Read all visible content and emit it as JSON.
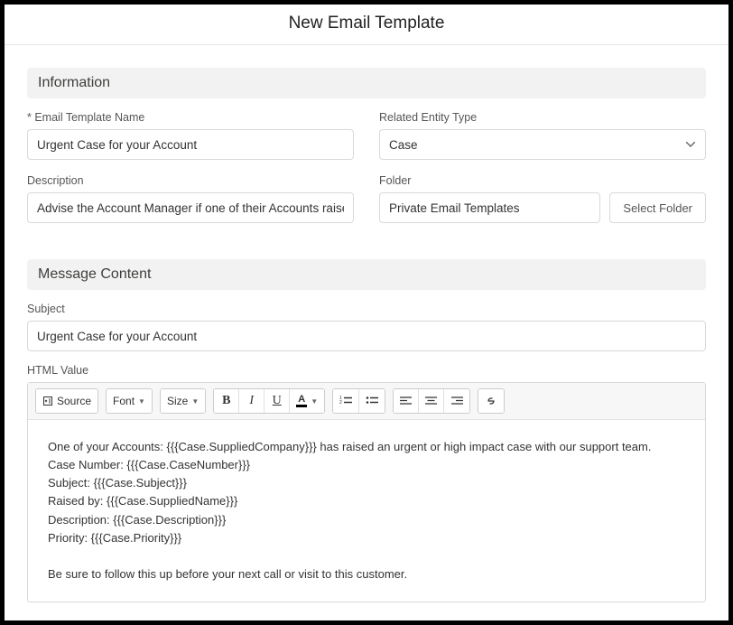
{
  "title": "New Email Template",
  "sections": {
    "info": "Information",
    "content": "Message Content"
  },
  "fields": {
    "name_label": "* Email Template Name",
    "name_value": "Urgent Case for your Account",
    "entity_label": "Related Entity Type",
    "entity_value": "Case",
    "desc_label": "Description",
    "desc_value": "Advise the Account Manager if one of their Accounts raises an urgent case",
    "folder_label": "Folder",
    "folder_value": "Private Email Templates",
    "select_folder_btn": "Select Folder",
    "subject_label": "Subject",
    "subject_value": "Urgent Case for your Account",
    "html_label": "HTML Value"
  },
  "toolbar": {
    "source": "Source",
    "font": "Font",
    "size": "Size",
    "bold": "B",
    "italic": "I",
    "underline": "U",
    "textcolor": "A"
  },
  "body_lines": [
    "One of your Accounts: {{{Case.SuppliedCompany}}} has raised an urgent or high impact case with our support team.",
    "Case Number: {{{Case.CaseNumber}}}",
    "Subject: {{{Case.Subject}}}",
    "Raised by: {{{Case.SuppliedName}}}",
    "Description: {{{Case.Description}}}",
    "Priority: {{{Case.Priority}}}",
    "",
    "Be sure to follow this up before your next call or visit to this customer."
  ]
}
